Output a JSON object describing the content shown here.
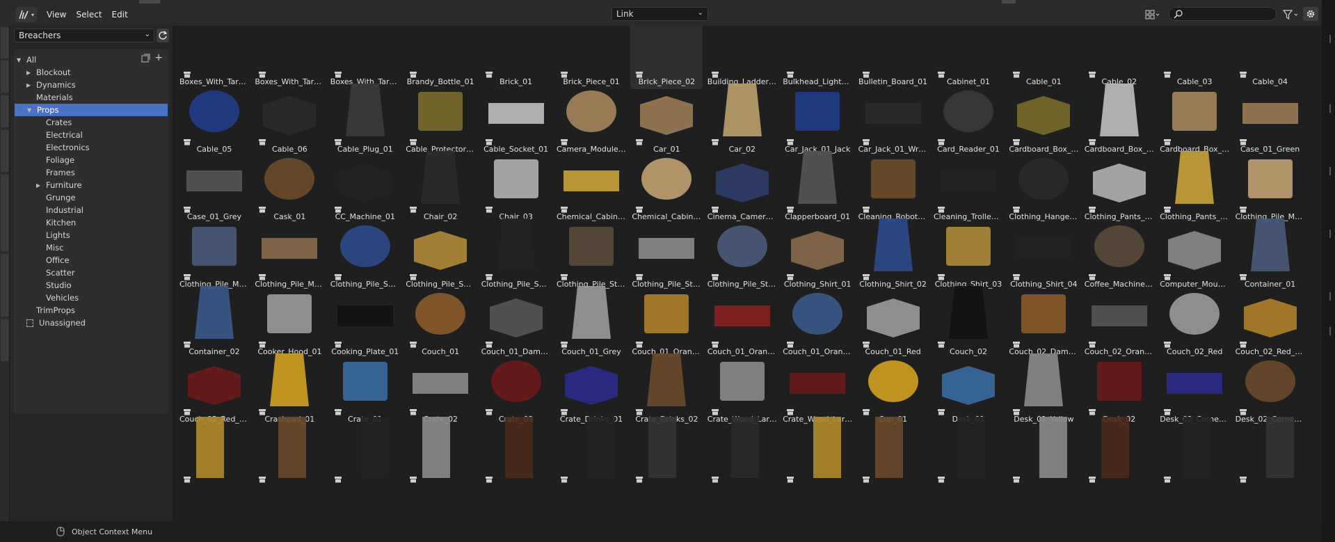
{
  "header": {
    "menus": [
      "View",
      "Select",
      "Edit"
    ],
    "import_method": "Link",
    "search_placeholder": ""
  },
  "sidebar": {
    "library": "Breachers",
    "catalogs": [
      {
        "label": "All",
        "indent": 0,
        "arrow": "down"
      },
      {
        "label": "Blockout",
        "indent": 1,
        "arrow": "right"
      },
      {
        "label": "Dynamics",
        "indent": 1,
        "arrow": "right"
      },
      {
        "label": "Materials",
        "indent": 1,
        "arrow": ""
      },
      {
        "label": "Props",
        "indent": 1,
        "arrow": "down",
        "selected": true
      },
      {
        "label": "Crates",
        "indent": 2,
        "arrow": ""
      },
      {
        "label": "Electrical",
        "indent": 2,
        "arrow": ""
      },
      {
        "label": "Electronics",
        "indent": 2,
        "arrow": ""
      },
      {
        "label": "Foliage",
        "indent": 2,
        "arrow": ""
      },
      {
        "label": "Frames",
        "indent": 2,
        "arrow": ""
      },
      {
        "label": "Furniture",
        "indent": 2,
        "arrow": "right"
      },
      {
        "label": "Grunge",
        "indent": 2,
        "arrow": ""
      },
      {
        "label": "Industrial",
        "indent": 2,
        "arrow": ""
      },
      {
        "label": "Kitchen",
        "indent": 2,
        "arrow": ""
      },
      {
        "label": "Lights",
        "indent": 2,
        "arrow": ""
      },
      {
        "label": "Misc",
        "indent": 2,
        "arrow": ""
      },
      {
        "label": "Office",
        "indent": 2,
        "arrow": ""
      },
      {
        "label": "Scatter",
        "indent": 2,
        "arrow": ""
      },
      {
        "label": "Studio",
        "indent": 2,
        "arrow": ""
      },
      {
        "label": "Vehicles",
        "indent": 2,
        "arrow": ""
      },
      {
        "label": "TrimProps",
        "indent": 1,
        "arrow": ""
      },
      {
        "label": "Unassigned",
        "indent": 0,
        "arrow": "",
        "icon": true
      }
    ]
  },
  "assets": [
    [
      "Boxes_With_Tarp_01",
      "Boxes_With_Tarp_0",
      "Boxes_With_Tarp_0",
      "Brandy_Bottle_01",
      "Brick_01",
      "Brick_Piece_01",
      "Brick_Piece_02",
      "Building_Ladder_01",
      "Bulkhead_Light_01",
      "Bulletin_Board_01",
      "Cabinet_01",
      "Cable_01",
      "Cable_02",
      "Cable_03",
      "Cable_04"
    ],
    [
      "Cable_05",
      "Cable_06",
      "Cable_Plug_01",
      "Cable_Protector_01",
      "Cable_Socket_01",
      "Camera_Module_01",
      "Car_01",
      "Car_02",
      "Car_Jack_01_Jack",
      "Car_Jack_01_Wren...",
      "Card_Reader_01",
      "Cardboard_Box_01",
      "Cardboard_Box_02",
      "Cardboard_Box_Clo",
      "Case_01_Green"
    ],
    [
      "Case_01_Grey",
      "Cask_01",
      "CC_Machine_01",
      "Chair_02",
      "Chair_03",
      "Chemical_Cabinet_...",
      "Chemical_Cabinet_...",
      "Cinema_Camera_01",
      "Clapperboard_01",
      "Cleaning_Robot_01",
      "Cleaning_Trolley_01",
      "Clothing_Hanger_01",
      "Clothing_Pants_01",
      "Clothing_Pants_02",
      "Clothing_Pile_Mess..."
    ],
    [
      "Clothing_Pile_Mess...",
      "Clothing_Pile_Mess...",
      "Clothing_Pile_Smal...",
      "Clothing_Pile_Smal...",
      "Clothing_Pile_Smal...",
      "Clothing_Pile_Strai...",
      "Clothing_Pile_Strai...",
      "Clothing_Pile_Strai...",
      "Clothing_Shirt_01",
      "Clothing_Shirt_02",
      "Clothing_Shirt_03",
      "Clothing_Shirt_04",
      "Coffee_Machine_01",
      "Computer_Mouse_...",
      "Container_01"
    ],
    [
      "Container_02",
      "Cooker_Hood_01",
      "Cooking_Plate_01",
      "Couch_01",
      "Couch_01_Damage",
      "Couch_01_Grey",
      "Couch_01_Orange",
      "Couch_01_Orange_",
      "Couch_01_Orange_",
      "Couch_01_Red",
      "Couch_02",
      "Couch_02_Damage",
      "Couch_02_Orange",
      "Couch_02_Red",
      "Couch_02_Red_No..."
    ],
    [
      "Couch_02_Red_Pill...",
      "Crashpad_01",
      "Crate_01",
      "Crate_02",
      "Crate_03",
      "Crate_Drinks_01",
      "Crate_Drinks_02",
      "Crate_Wood_Large...",
      "Crate_Wood_Large...",
      "Cup_01",
      "Desk_01",
      "Desk_01_Yellow",
      "Desk_02",
      "Desk_02_Corner_L...",
      "Desk_02_Corner_S..."
    ],
    [
      "",
      "",
      "",
      "",
      "",
      "",
      "",
      "",
      "",
      "",
      "",
      "",
      "",
      "",
      ""
    ]
  ],
  "highlighted_asset": "Brick_Piece_02",
  "status": {
    "context_menu": "Object Context Menu"
  }
}
